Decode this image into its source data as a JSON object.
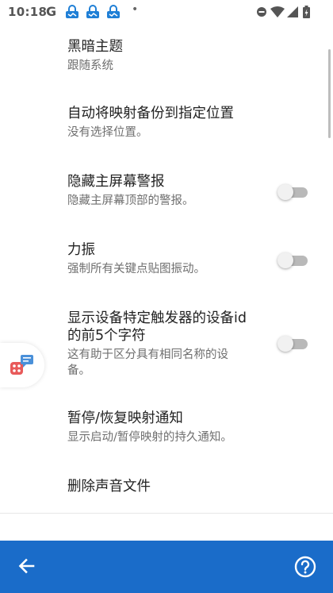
{
  "status_bar": {
    "time": "10:18",
    "google_letter": "G",
    "notification_icons": [
      "lock-notification-icon",
      "lock-notification-icon",
      "lock-notification-icon"
    ],
    "dot": "•",
    "right_icons": [
      "do-not-disturb-icon",
      "wifi-icon",
      "signal-icon",
      "battery-charging-icon"
    ]
  },
  "settings": [
    {
      "title": "黑暗主题",
      "summary": "跟随系统"
    },
    {
      "title": "自动将映射备份到指定位置",
      "summary": "没有选择位置。"
    },
    {
      "title": "隐藏主屏幕警报",
      "summary": "隐藏主屏幕顶部的警报。",
      "toggle": false
    },
    {
      "title": "力振",
      "summary": "强制所有关键点贴图振动。",
      "toggle": false
    },
    {
      "title_line1": "显示设备特定触发器的设备id",
      "title_line2": "的前5个字符",
      "summary_line1": "这有助于区分具有相同名称的设",
      "summary_line2": "备。",
      "toggle": false
    },
    {
      "title": "暂停/恢复映射通知",
      "summary": "显示启动/暂停映射的持久通知。"
    },
    {
      "title": "删除声音文件"
    }
  ],
  "floating_widget": {
    "icon": "game-controller-chat-icon"
  },
  "bottom_bar": {
    "back_icon": "arrow-back-icon",
    "help_icon": "help-circle-icon",
    "color": "#1a6cc9"
  },
  "colors": {
    "title_text": "#222222",
    "summary_text": "#6f6f6f",
    "switch_track_off": "#b9b9b9",
    "accent": "#1a6cc9"
  }
}
